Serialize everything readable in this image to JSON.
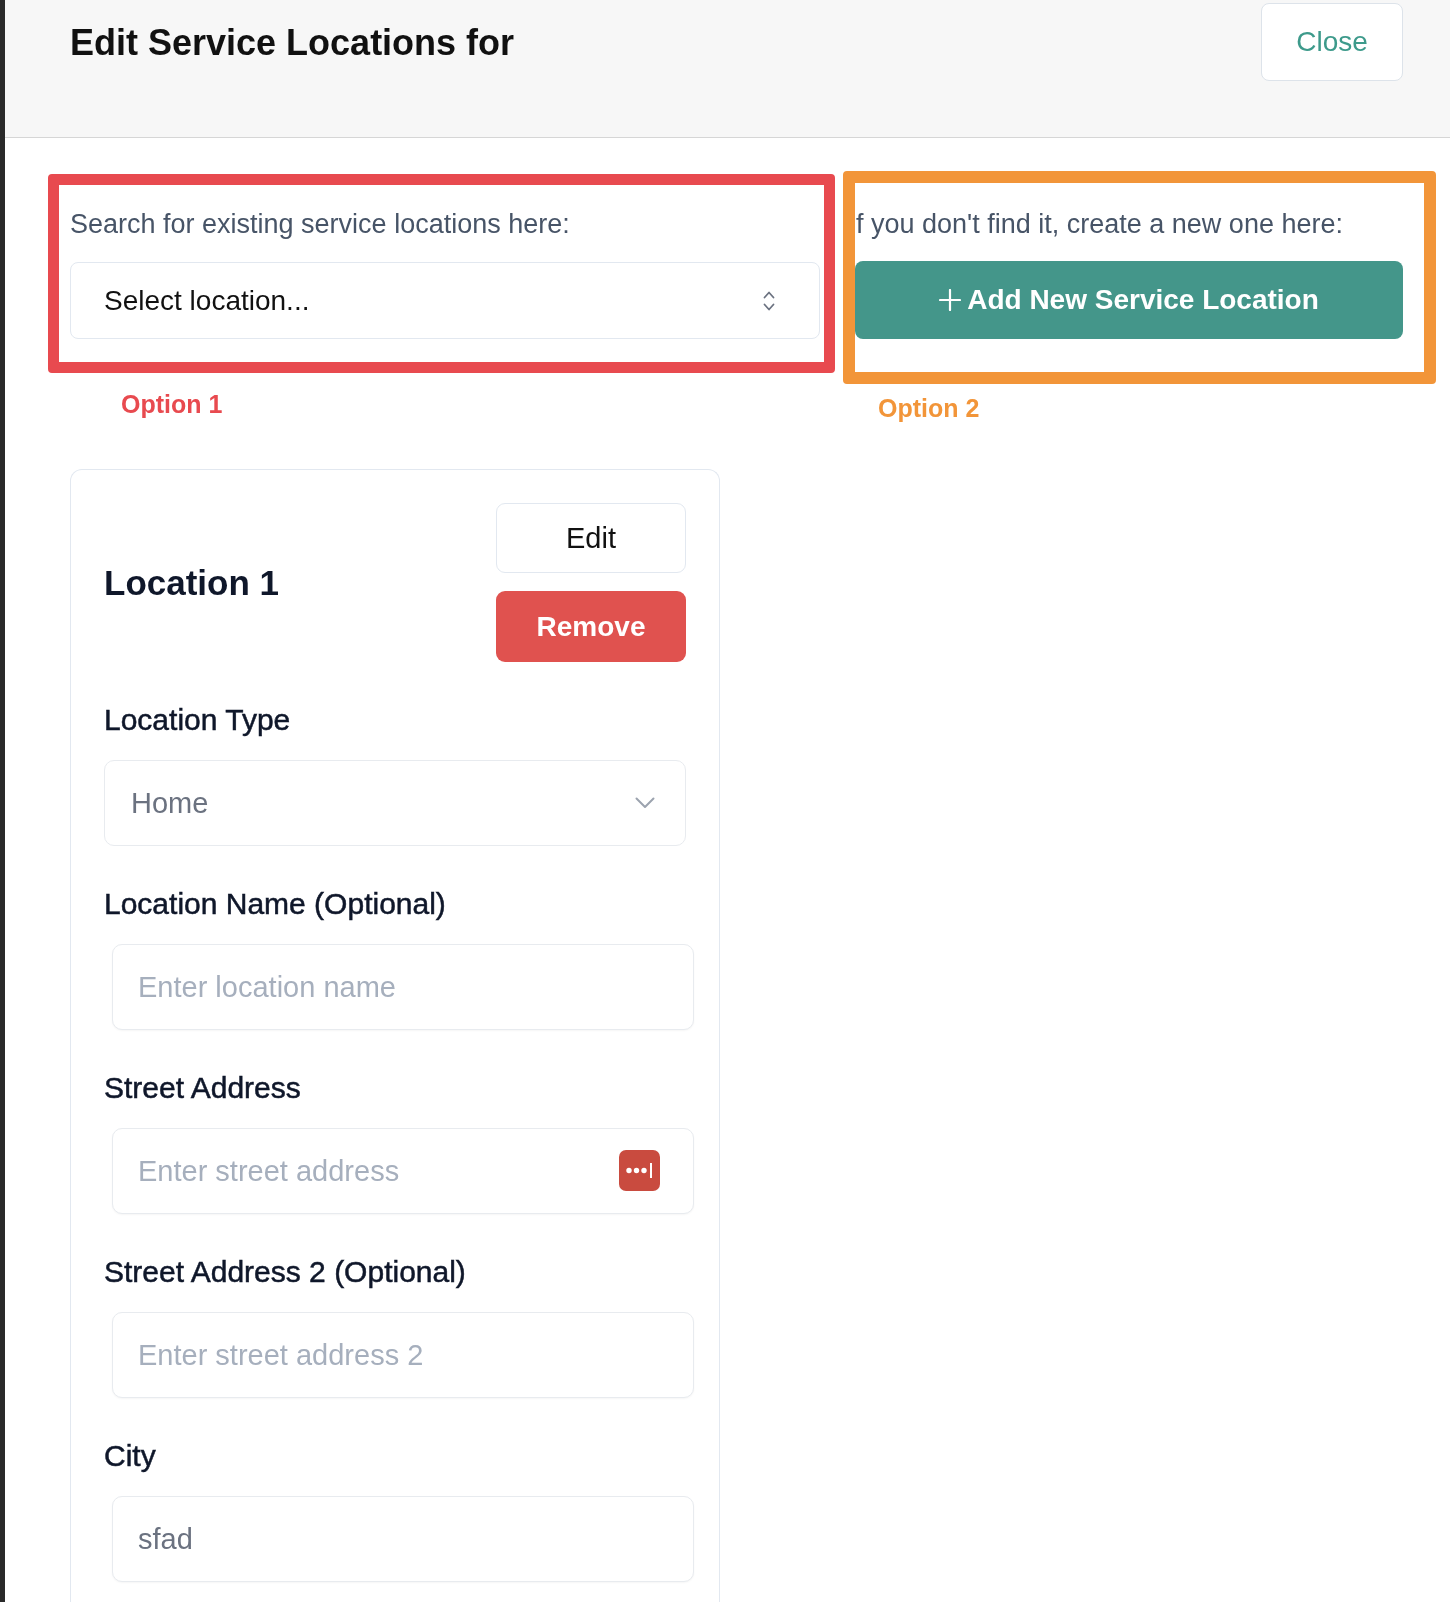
{
  "header": {
    "title": "Edit Service Locations for",
    "close_button": "Close"
  },
  "options": [
    {
      "kind": "search",
      "label": "Option 1",
      "color": "#e84a4f",
      "prompt": "Search for existing service locations here:",
      "select": {
        "placeholder": "Select location..."
      }
    },
    {
      "kind": "create",
      "label": "Option 2",
      "color": "#f29539",
      "prompt": "f you don't find it, create a new one here:",
      "button": "Add New Service Location"
    }
  ],
  "card": {
    "title": "Location 1",
    "buttons": [
      {
        "kind": "edit",
        "label": "Edit"
      },
      {
        "kind": "remove",
        "label": "Remove"
      }
    ],
    "fields": [
      {
        "kind": "select",
        "label": "Location Type",
        "value": "Home",
        "autofill_icon": false
      },
      {
        "kind": "text",
        "label": "Location Name (Optional)",
        "placeholder": "Enter location name",
        "autofill_icon": false
      },
      {
        "kind": "text",
        "label": "Street Address",
        "placeholder": "Enter street address",
        "autofill_icon": true
      },
      {
        "kind": "text",
        "label": "Street Address 2 (Optional)",
        "placeholder": "Enter street address 2",
        "autofill_icon": false
      },
      {
        "kind": "text",
        "label": "City",
        "value": "sfad",
        "autofill_icon": false
      }
    ]
  }
}
